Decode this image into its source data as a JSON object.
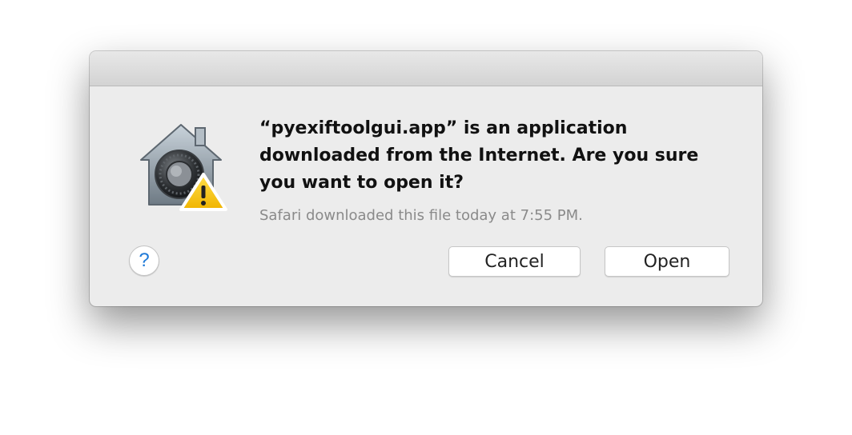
{
  "dialog": {
    "message": "“pyexiftoolgui.app” is an application downloaded from the Internet. Are you sure you want to open it?",
    "info": "Safari downloaded this file today at 7:55 PM.",
    "help_label": "?",
    "cancel_label": "Cancel",
    "open_label": "Open",
    "icon": "gatekeeper-vault-warning-icon"
  },
  "colors": {
    "dialog_background": "#ececec",
    "help_glyph": "#1f7ad8",
    "warning": "#f5c400",
    "info_text": "#8a8a8a"
  }
}
